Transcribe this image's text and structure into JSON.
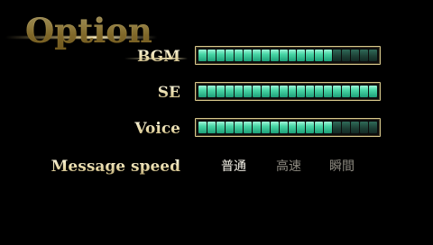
{
  "screen": {
    "title": "Option"
  },
  "settings": {
    "bgm": {
      "label": "BGM",
      "segments": 20,
      "level": 15
    },
    "se": {
      "label": "SE",
      "segments": 20,
      "level": 20
    },
    "voice": {
      "label": "Voice",
      "segments": 20,
      "level": 15
    },
    "message_speed": {
      "label": "Message speed",
      "options": [
        "普通",
        "高速",
        "瞬間"
      ],
      "selected": "普通"
    }
  },
  "colors": {
    "accent_gold": "#e6d8a6",
    "bar_on": "#48d6a6",
    "bar_off": "#1c3e34"
  }
}
